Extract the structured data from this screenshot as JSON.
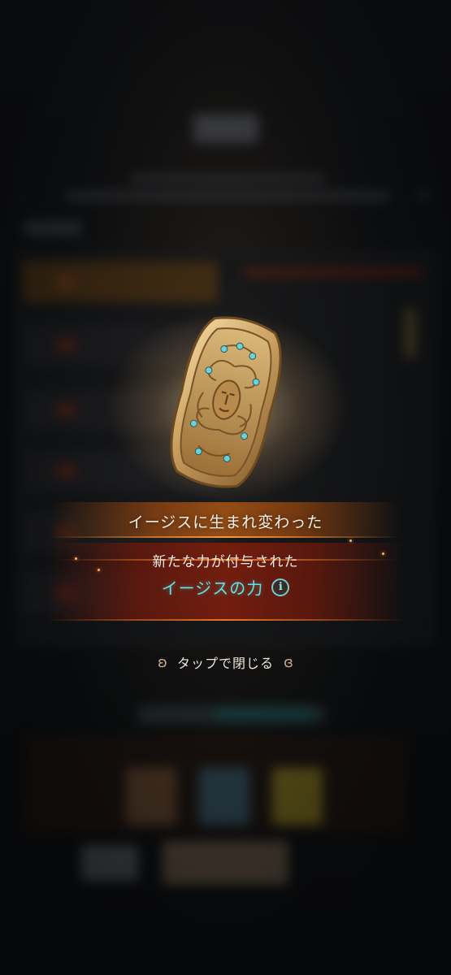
{
  "modal": {
    "reborn_message": "イージスに生まれ変わった",
    "new_power_message": "新たな力が付与された",
    "power_name": "イージスの力",
    "info_icon": "info-icon",
    "info_symbol": "i",
    "close_label": "タップで閉じる"
  },
  "item": {
    "icon": "aegis-shield-icon"
  },
  "colors": {
    "power_name": "#5fe3ea",
    "banner_orange": "#aa5514",
    "banner_red": "#82200c"
  }
}
